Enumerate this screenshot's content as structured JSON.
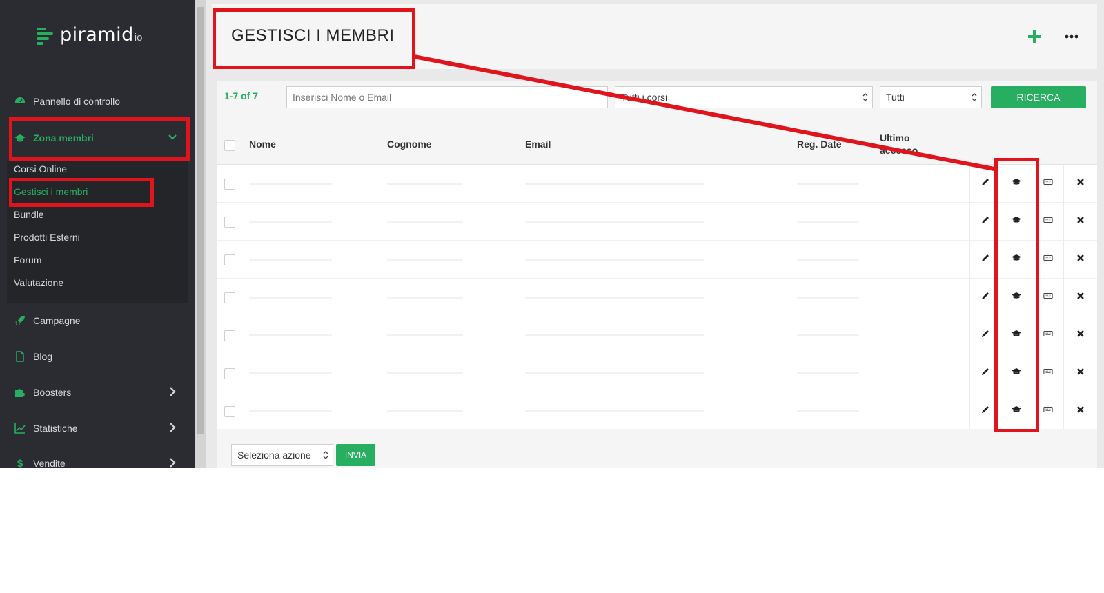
{
  "app": {
    "logo_text": "piramid",
    "logo_suffix": "io"
  },
  "sidebar": {
    "items": [
      {
        "label": "Pannello di controllo",
        "icon": "dashboard-icon"
      },
      {
        "label": "Zona membri",
        "icon": "graduation-cap-icon",
        "active": true
      },
      {
        "label": "Campagne",
        "icon": "rocket-icon"
      },
      {
        "label": "Blog",
        "icon": "file-icon"
      },
      {
        "label": "Boosters",
        "icon": "puzzle-icon"
      },
      {
        "label": "Statistiche",
        "icon": "line-chart-icon"
      },
      {
        "label": "Vendite",
        "icon": "dollar-icon"
      }
    ],
    "submenu": [
      {
        "label": "Corsi Online"
      },
      {
        "label": "Gestisci i membri",
        "active": true
      },
      {
        "label": "Bundle"
      },
      {
        "label": "Prodotti Esterni"
      },
      {
        "label": "Forum"
      },
      {
        "label": "Valutazione"
      }
    ]
  },
  "header": {
    "title": "GESTISCI I MEMBRI"
  },
  "filters": {
    "count": "1-7 of 7",
    "search_placeholder": "Inserisci Nome o Email",
    "course_select": "Tutti i corsi",
    "status_select": "Tutti",
    "search_button": "RICERCA"
  },
  "table": {
    "columns": [
      "Nome",
      "Cognome",
      "Email",
      "Reg. Date",
      "Ultimo accesso"
    ],
    "row_count": 7
  },
  "bottom": {
    "action_select": "Seleziona azione",
    "submit_button": "INVIA"
  },
  "colors": {
    "accent": "#27ae60",
    "sidebar": "#2b2c31",
    "annotation": "#e0141d"
  }
}
